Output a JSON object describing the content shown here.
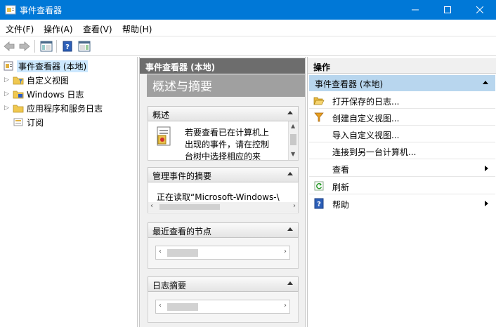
{
  "window": {
    "title": "事件查看器"
  },
  "menu": [
    "文件(F)",
    "操作(A)",
    "查看(V)",
    "帮助(H)"
  ],
  "tree": {
    "root": "事件查看器 (本地)",
    "items": [
      "自定义视图",
      "Windows 日志",
      "应用程序和服务日志",
      "订阅"
    ]
  },
  "middle": {
    "header": "事件查看器 (本地)",
    "title": "概述与摘要",
    "overview": {
      "title": "概述",
      "text": [
        "若要查看已在计算机上",
        "出现的事件，请在控制",
        "台树中选择相应的来"
      ]
    },
    "summary": {
      "title": "管理事件的摘要",
      "text": "正在读取“Microsoft-Windows-\\"
    },
    "recent": {
      "title": "最近查看的节点"
    },
    "logs": {
      "title": "日志摘要"
    }
  },
  "actions": {
    "header": "操作",
    "group": "事件查看器 (本地)",
    "items": [
      "打开保存的日志...",
      "创建自定义视图...",
      "导入自定义视图...",
      "连接到另一台计算机...",
      "查看",
      "刷新",
      "帮助"
    ]
  },
  "colors": {
    "titlebar": "#0078d7",
    "selection": "#cce8ff",
    "action_group": "#b8d6ee"
  }
}
